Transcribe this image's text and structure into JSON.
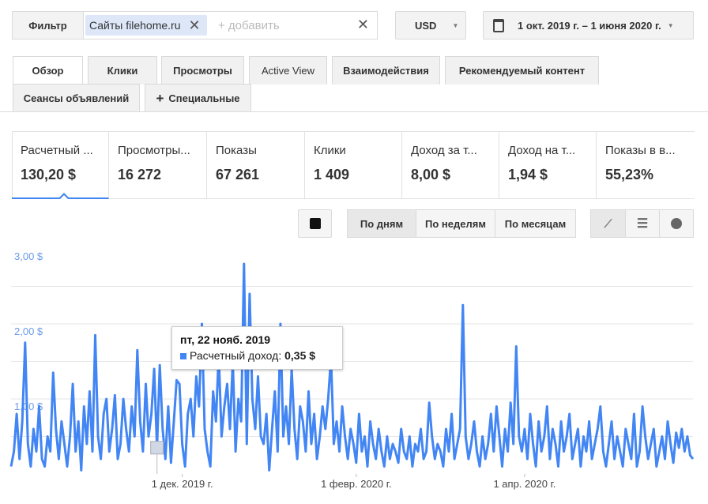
{
  "filter": {
    "label": "Фильтр",
    "chip_prefix": "Сайты",
    "chip_value": "filehome.ru",
    "add_placeholder": "+ добавить"
  },
  "currency": "USD",
  "date_range": "1 окт. 2019 г. – 1 июня 2020 г.",
  "tabs": [
    "Обзор",
    "Клики",
    "Просмотры",
    "Active View",
    "Взаимодействия",
    "Рекомендуемый контент",
    "Сеансы объявлений",
    "Специальные"
  ],
  "metrics": [
    {
      "label": "Расчетный ...",
      "value": "130,20 $"
    },
    {
      "label": "Просмотры...",
      "value": "16 272"
    },
    {
      "label": "Показы",
      "value": "67 261"
    },
    {
      "label": "Клики",
      "value": "1 409"
    },
    {
      "label": "Доход за т...",
      "value": "8,00 $"
    },
    {
      "label": "Доход на т...",
      "value": "1,94 $"
    },
    {
      "label": "Показы в в...",
      "value": "55,23%"
    }
  ],
  "granularity": [
    "По дням",
    "По неделям",
    "По месяцам"
  ],
  "tooltip": {
    "date": "пт, 22 нояб. 2019",
    "series": "Расчетный доход:",
    "value": "0,35 $"
  },
  "chart_data": {
    "type": "line",
    "series_name": "Расчетный доход",
    "color": "#4285f4",
    "x_start": "2019-10-01",
    "x_end": "2020-06-01",
    "ylim": [
      0,
      3
    ],
    "y_ticks": [
      "3,00 $",
      "2,00 $",
      "1,00 $"
    ],
    "x_ticks": [
      {
        "day": 61,
        "label": "1 дек. 2019 г."
      },
      {
        "day": 123,
        "label": "1 февр. 2020 г."
      },
      {
        "day": 183,
        "label": "1 апр. 2020 г."
      }
    ],
    "values": [
      0.1,
      0.3,
      0.8,
      0.2,
      0.7,
      1.75,
      0.4,
      0.1,
      0.6,
      0.3,
      0.9,
      0.2,
      0.1,
      0.5,
      0.3,
      1.35,
      0.6,
      0.2,
      0.7,
      0.4,
      0.1,
      0.5,
      1.2,
      0.3,
      0.7,
      0.05,
      0.9,
      0.4,
      1.1,
      0.3,
      1.85,
      0.5,
      0.2,
      0.8,
      1.0,
      0.3,
      0.6,
      1.05,
      0.2,
      0.4,
      1.0,
      0.6,
      0.3,
      0.9,
      0.5,
      1.65,
      0.7,
      0.3,
      1.2,
      0.5,
      0.8,
      1.4,
      0.35,
      1.45,
      0.6,
      0.2,
      0.9,
      0.15,
      0.7,
      1.25,
      1.2,
      0.4,
      0.1,
      0.8,
      1.0,
      0.5,
      1.3,
      0.9,
      2.0,
      0.6,
      0.3,
      0.1,
      1.1,
      0.7,
      1.6,
      0.5,
      0.9,
      1.2,
      0.6,
      1.5,
      0.3,
      1.0,
      0.7,
      2.8,
      0.4,
      2.4,
      1.0,
      0.6,
      1.3,
      0.5,
      0.4,
      0.8,
      0.05,
      0.6,
      1.1,
      0.3,
      2.0,
      0.5,
      0.9,
      0.4,
      1.4,
      0.6,
      0.2,
      0.9,
      0.7,
      0.3,
      1.1,
      0.4,
      0.8,
      0.2,
      0.5,
      0.9,
      0.6,
      1.0,
      1.55,
      0.4,
      0.7,
      0.3,
      0.9,
      0.5,
      0.2,
      0.6,
      0.4,
      0.15,
      0.8,
      0.3,
      0.5,
      0.1,
      0.7,
      0.4,
      0.2,
      0.6,
      0.3,
      0.1,
      0.5,
      0.2,
      0.4,
      0.3,
      0.15,
      0.6,
      0.3,
      0.2,
      0.5,
      0.1,
      0.4,
      0.3,
      0.6,
      0.2,
      0.3,
      0.95,
      0.5,
      0.2,
      0.4,
      0.3,
      0.1,
      0.6,
      0.3,
      0.8,
      0.2,
      0.4,
      0.6,
      2.25,
      0.5,
      0.2,
      0.4,
      0.7,
      0.3,
      0.1,
      0.5,
      0.2,
      0.4,
      0.8,
      0.3,
      0.9,
      0.5,
      0.1,
      0.6,
      0.3,
      0.95,
      0.4,
      1.7,
      0.5,
      0.3,
      0.6,
      0.2,
      0.8,
      0.4,
      0.1,
      0.7,
      0.3,
      0.5,
      0.9,
      0.2,
      0.6,
      0.4,
      0.1,
      0.7,
      0.3,
      0.5,
      0.8,
      0.2,
      0.4,
      0.6,
      0.1,
      0.5,
      0.3,
      0.7,
      0.2,
      0.4,
      0.6,
      0.9,
      0.3,
      0.1,
      0.4,
      0.7,
      0.2,
      0.5,
      0.3,
      0.1,
      0.6,
      0.4,
      0.2,
      0.8,
      0.1,
      0.3,
      0.9,
      0.5,
      0.2,
      0.4,
      0.6,
      0.1,
      0.3,
      0.5,
      0.2,
      0.7,
      0.4,
      0.15,
      0.55,
      0.35,
      0.6,
      0.3,
      0.5,
      0.25,
      0.2
    ],
    "highlight_day": 52
  }
}
